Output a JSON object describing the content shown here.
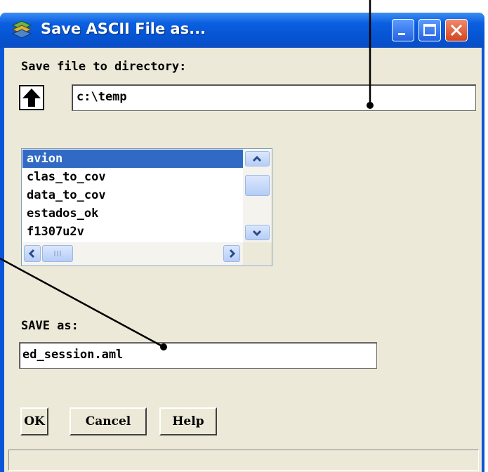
{
  "window": {
    "title": "Save ASCII File as...",
    "buttons": [
      "minimize",
      "maximize",
      "close"
    ]
  },
  "directory": {
    "label": "Save file to directory:",
    "value": "c:\\temp",
    "up_icon": "arrow-up-icon"
  },
  "file_list": {
    "items": [
      "avion",
      "clas_to_cov",
      "data_to_cov",
      "estados_ok",
      "f1307u2v"
    ],
    "selected": "avion"
  },
  "save_as": {
    "label": "SAVE as:",
    "value": "ed_session.aml"
  },
  "actions": {
    "ok": "OK",
    "cancel": "Cancel",
    "help": "Help"
  },
  "colors": {
    "titlebar": "#0a5fe0",
    "selection": "#316ac5",
    "client": "#ece9d8",
    "close_button": "#d5451d"
  }
}
